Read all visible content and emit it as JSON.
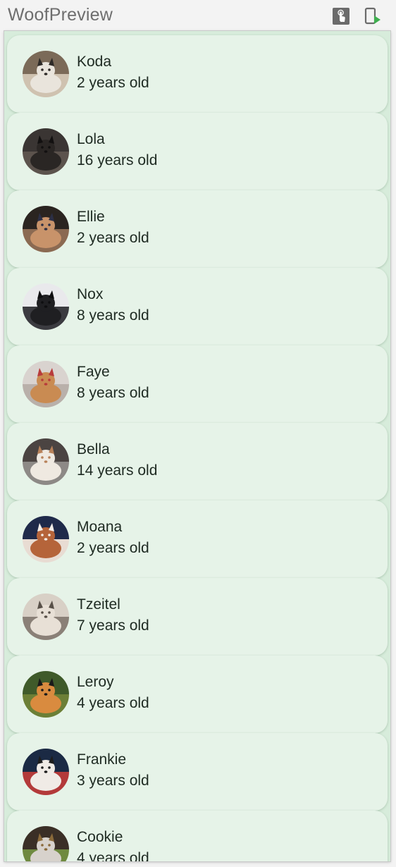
{
  "app": {
    "title": "WoofPreview",
    "toolbar": {
      "interactive_icon": "interactive-mode-icon",
      "deploy_icon": "deploy-to-device-icon"
    }
  },
  "dogs": [
    {
      "name": "Koda",
      "age": "2 years old"
    },
    {
      "name": "Lola",
      "age": "16 years old"
    },
    {
      "name": "Ellie",
      "age": "2 years old"
    },
    {
      "name": "Nox",
      "age": "8 years old"
    },
    {
      "name": "Faye",
      "age": "8 years old"
    },
    {
      "name": "Bella",
      "age": "14 years old"
    },
    {
      "name": "Moana",
      "age": "2 years old"
    },
    {
      "name": "Tzeitel",
      "age": "7 years old"
    },
    {
      "name": "Leroy",
      "age": "4 years old"
    },
    {
      "name": "Frankie",
      "age": "3 years old"
    },
    {
      "name": "Cookie",
      "age": "4 years old"
    }
  ],
  "colors": {
    "card_background": "#e6f3e8",
    "list_background": "#d7ecdb",
    "text": "#1e2a22",
    "title_text": "#6e6e6e",
    "deploy_accent": "#3fae4f"
  }
}
